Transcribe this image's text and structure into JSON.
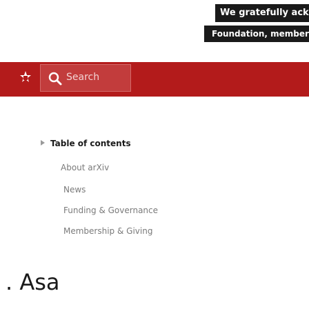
{
  "banner": {
    "line1": "We gratefully acknowledge",
    "line2": "Foundation, member institutions"
  },
  "header": {
    "menu_icon": "menu-icon",
    "search": {
      "placeholder": "Search",
      "icon": "search-icon"
    },
    "accent_color": "#b31b1b"
  },
  "toc": {
    "title": "Table of contents",
    "items": [
      "About arXiv",
      "News",
      "Funding & Governance",
      "Membership & Giving"
    ]
  },
  "partial_brand_text": ". Asa"
}
